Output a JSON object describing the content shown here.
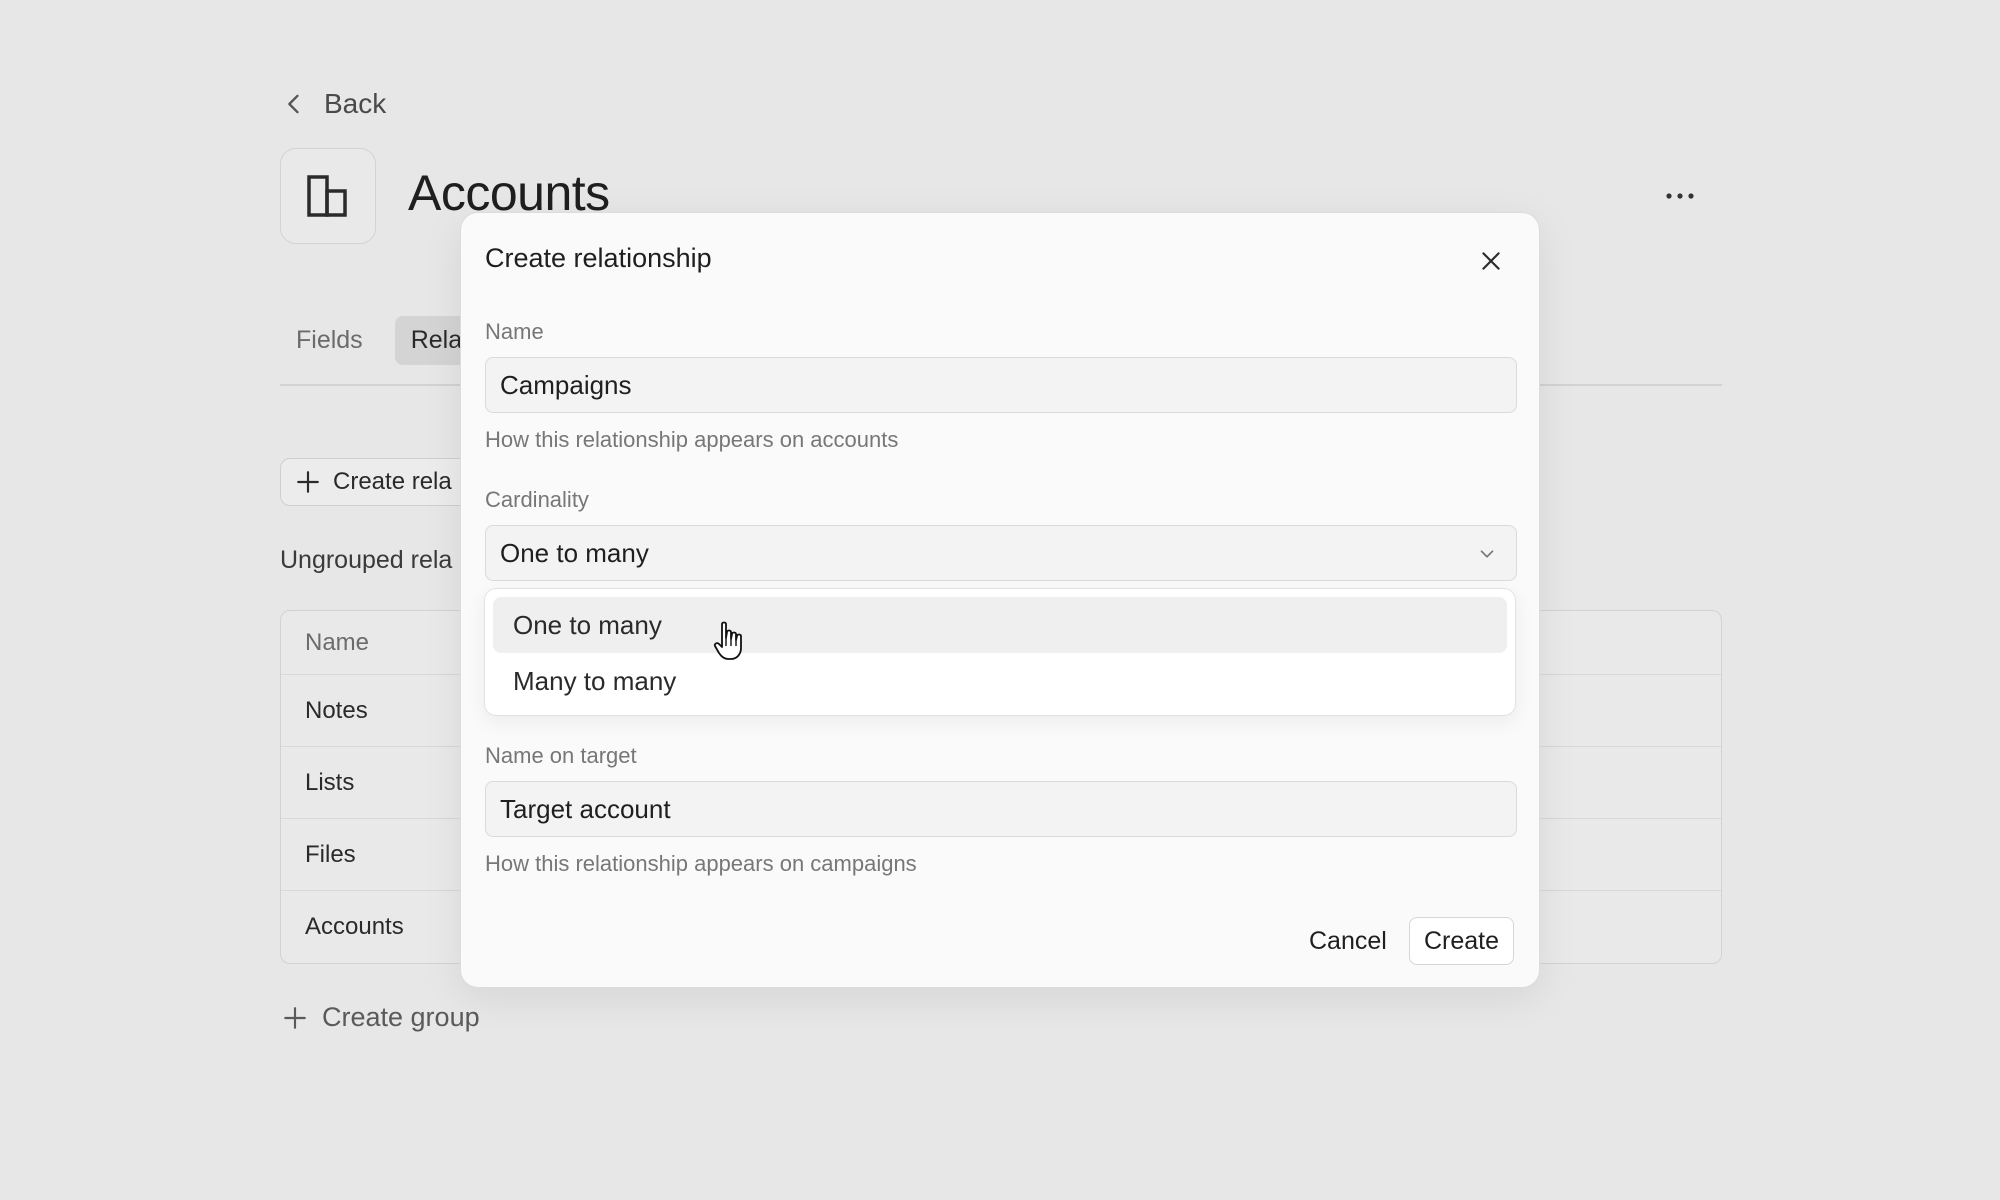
{
  "header": {
    "back_label": "Back",
    "title": "Accounts",
    "object_icon": "building-icon",
    "more_icon": "more-horizontal-icon"
  },
  "tabs": [
    {
      "label": "Fields"
    },
    {
      "label": "Rela"
    }
  ],
  "actions": {
    "create_relationship_label": "Create rela"
  },
  "section": {
    "title": "Ungrouped rela"
  },
  "table": {
    "header": "Name",
    "rows": [
      "Notes",
      "Lists",
      "Files",
      "Accounts"
    ]
  },
  "create_group_label": "Create group",
  "modal": {
    "title": "Create relationship",
    "name_label": "Name",
    "name_value": "Campaigns",
    "name_help": "How this relationship appears on accounts",
    "cardinality_label": "Cardinality",
    "cardinality_value": "One to many",
    "cardinality_options": [
      "One to many",
      "Many to many"
    ],
    "target_label": "Name on target",
    "target_value": "Target account",
    "target_help": "How this relationship appears on campaigns",
    "cancel_label": "Cancel",
    "create_label": "Create"
  }
}
